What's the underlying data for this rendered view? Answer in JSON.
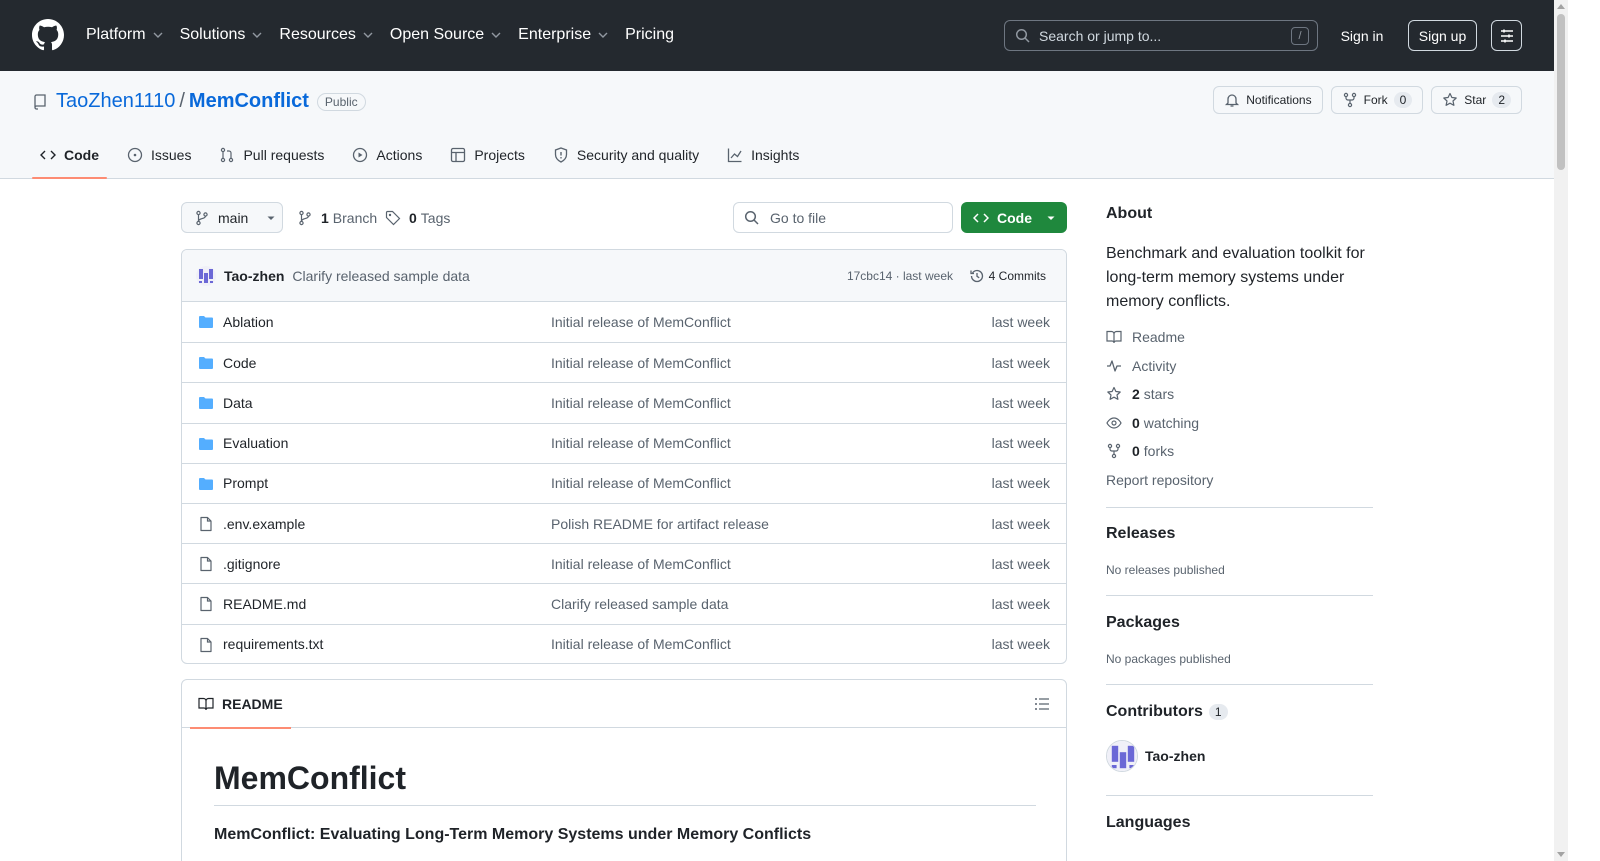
{
  "header": {
    "nav": [
      "Platform",
      "Solutions",
      "Resources",
      "Open Source",
      "Enterprise",
      "Pricing"
    ],
    "search_placeholder": "Search or jump to...",
    "search_shortcut": "/",
    "signin": "Sign in",
    "signup": "Sign up"
  },
  "repo": {
    "owner": "TaoZhen1110",
    "separator": "/",
    "name": "MemConflict",
    "visibility": "Public",
    "notifications": "Notifications",
    "fork_label": "Fork",
    "fork_count": "0",
    "star_label": "Star",
    "star_count": "2"
  },
  "tabs": [
    "Code",
    "Issues",
    "Pull requests",
    "Actions",
    "Projects",
    "Security and quality",
    "Insights"
  ],
  "toolbar": {
    "branch": "main",
    "branches_count": "1",
    "branches_label": "Branch",
    "tags_count": "0",
    "tags_label": "Tags",
    "goto_placeholder": "Go to file",
    "code_button": "Code"
  },
  "commit": {
    "author": "Tao-zhen",
    "message": "Clarify released sample data",
    "sha_time": "17cbc14 · last week",
    "commits": "4 Commits"
  },
  "files": [
    {
      "name": "Ablation",
      "type": "dir",
      "message": "Initial release of MemConflict",
      "date": "last week"
    },
    {
      "name": "Code",
      "type": "dir",
      "message": "Initial release of MemConflict",
      "date": "last week"
    },
    {
      "name": "Data",
      "type": "dir",
      "message": "Initial release of MemConflict",
      "date": "last week"
    },
    {
      "name": "Evaluation",
      "type": "dir",
      "message": "Initial release of MemConflict",
      "date": "last week"
    },
    {
      "name": "Prompt",
      "type": "dir",
      "message": "Initial release of MemConflict",
      "date": "last week"
    },
    {
      "name": ".env.example",
      "type": "file",
      "message": "Polish README for artifact release",
      "date": "last week"
    },
    {
      "name": ".gitignore",
      "type": "file",
      "message": "Initial release of MemConflict",
      "date": "last week"
    },
    {
      "name": "README.md",
      "type": "file",
      "message": "Clarify released sample data",
      "date": "last week"
    },
    {
      "name": "requirements.txt",
      "type": "file",
      "message": "Initial release of MemConflict",
      "date": "last week"
    }
  ],
  "readme": {
    "tab": "README",
    "title": "MemConflict",
    "subtitle": "MemConflict: Evaluating Long-Term Memory Systems under Memory Conflicts"
  },
  "sidebar": {
    "about_title": "About",
    "description": "Benchmark and evaluation toolkit for long-term memory systems under memory conflicts.",
    "readme": "Readme",
    "activity": "Activity",
    "stars_count": "2",
    "stars_label": "stars",
    "watching_count": "0",
    "watching_label": "watching",
    "forks_count": "0",
    "forks_label": "forks",
    "report": "Report repository",
    "releases_title": "Releases",
    "releases_empty": "No releases published",
    "packages_title": "Packages",
    "packages_empty": "No packages published",
    "contributors_title": "Contributors",
    "contributors_count": "1",
    "contributor_name": "Tao-zhen",
    "languages_title": "Languages"
  },
  "colors": {
    "header_bg": "#24292f",
    "link": "#0969da",
    "primary_button": "#1f883d",
    "tab_underline": "#fd8c73",
    "folder": "#54aeff"
  }
}
